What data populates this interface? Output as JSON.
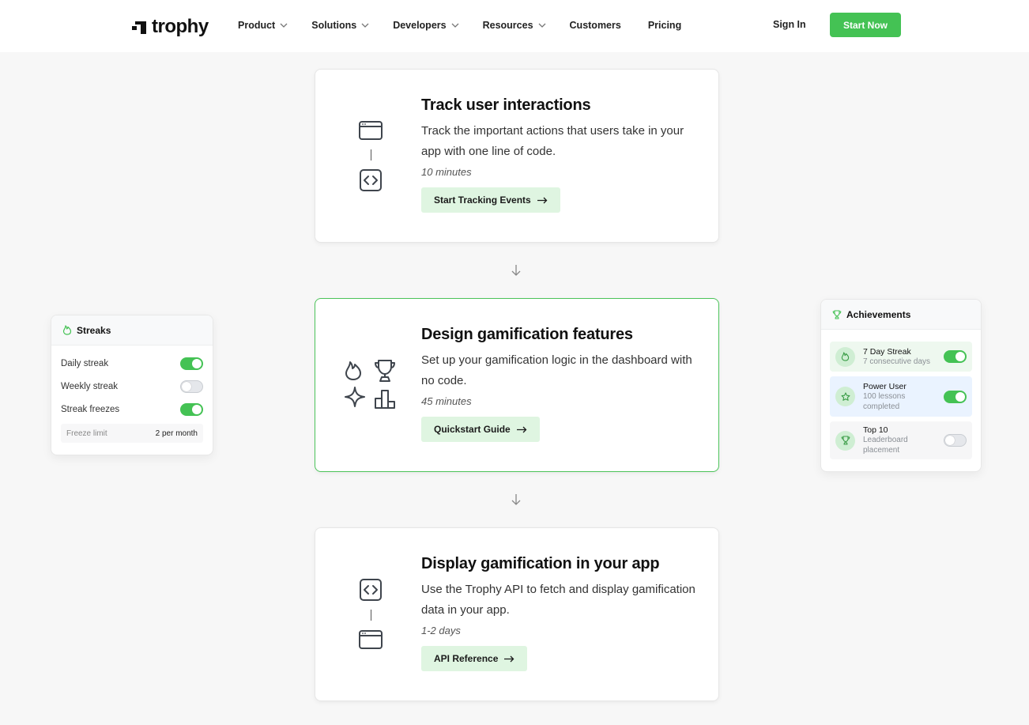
{
  "nav": {
    "logo": "trophy",
    "links": [
      {
        "label": "Product",
        "dropdown": true
      },
      {
        "label": "Solutions",
        "dropdown": true
      },
      {
        "label": "Developers",
        "dropdown": true
      },
      {
        "label": "Resources",
        "dropdown": true
      },
      {
        "label": "Customers",
        "dropdown": false
      },
      {
        "label": "Pricing",
        "dropdown": false
      }
    ],
    "sign_in": "Sign In",
    "start_now": "Start Now"
  },
  "steps": [
    {
      "title": "Track user interactions",
      "description": "Track the important actions that users take in your app with one line of code.",
      "time": "10 minutes",
      "button": "Start Tracking Events"
    },
    {
      "title": "Design gamification features",
      "description": "Set up your gamification logic in the dashboard with no code.",
      "time": "45 minutes",
      "button": "Quickstart Guide"
    },
    {
      "title": "Display gamification in your app",
      "description": "Use the Trophy API to fetch and display gamification data in your app.",
      "time": "1-2 days",
      "button": "API Reference"
    }
  ],
  "streaks": {
    "title": "Streaks",
    "rows": [
      {
        "label": "Daily streak",
        "enabled": true
      },
      {
        "label": "Weekly streak",
        "enabled": false
      },
      {
        "label": "Streak freezes",
        "enabled": true
      }
    ],
    "freeze_label": "Freeze limit",
    "freeze_value": "2 per month"
  },
  "achievements": {
    "title": "Achievements",
    "items": [
      {
        "name": "7 Day Streak",
        "sub": "7 consecutive days",
        "enabled": true,
        "icon": "flame-icon",
        "bg": "#eef8ef"
      },
      {
        "name": "Power User",
        "sub": "100 lessons completed",
        "enabled": true,
        "icon": "star-icon",
        "bg": "#eaf3ff"
      },
      {
        "name": "Top 10",
        "sub": "Leaderboard placement",
        "enabled": false,
        "icon": "trophy-icon",
        "bg": "#f6f6f7"
      }
    ]
  },
  "colors": {
    "accent": "#44c254",
    "button_bg": "#dff5e1"
  }
}
